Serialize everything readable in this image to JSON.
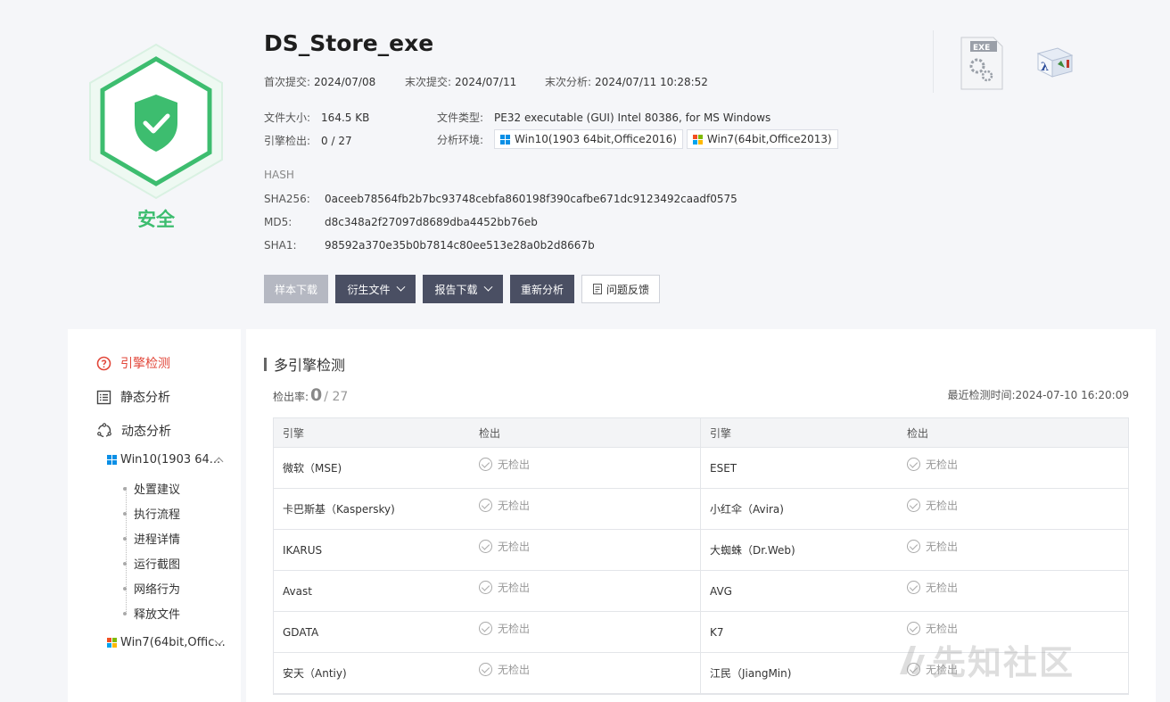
{
  "file": {
    "name": "DS_Store_exe",
    "verdict": "安全",
    "first_submit_label": "首次提交:",
    "first_submit": "2024/07/08",
    "last_submit_label": "末次提交:",
    "last_submit": "2024/07/11",
    "last_analysis_label": "末次分析:",
    "last_analysis": "2024/07/11 10:28:52",
    "size_label": "文件大小:",
    "size": "164.5 KB",
    "type_label": "文件类型:",
    "type": "PE32 executable (GUI) Intel 80386, for MS Windows",
    "detect_label": "引擎检出:",
    "detect": "0 / 27",
    "env_label": "分析环境:",
    "envs": [
      "Win10(1903 64bit,Office2016)",
      "Win7(64bit,Office2013)"
    ]
  },
  "hash": {
    "heading": "HASH",
    "sha256_label": "SHA256:",
    "sha256": "0aceeb78564fb2b7bc93748cebfa860198f390cafbe671dc9123492caadf0575",
    "md5_label": "MD5:",
    "md5": "d8c348a2f27097d8689dba4452bb76eb",
    "sha1_label": "SHA1:",
    "sha1": "98592a370e35b0b7814c80ee513e28a0b2d8667b"
  },
  "actions": {
    "sample_download": "样本下载",
    "derived_files": "衍生文件",
    "report_download": "报告下载",
    "reanalyze": "重新分析",
    "feedback": "问题反馈"
  },
  "sidebar": {
    "engine": "引擎检测",
    "static": "静态分析",
    "dynamic": "动态分析",
    "env1": "Win10(1903 64...",
    "env2": "Win7(64bit,Offic...",
    "sub_items": [
      "处置建议",
      "执行流程",
      "进程详情",
      "运行截图",
      "网络行为",
      "释放文件"
    ]
  },
  "panel": {
    "title": "多引擎检测",
    "rate_label": "检出率:",
    "rate_count": "0",
    "rate_total": "/ 27",
    "last_time_label": "最近检测时间:",
    "last_time": "2024-07-10 16:20:09",
    "col_engine": "引擎",
    "col_result": "检出",
    "rows": [
      {
        "e1": "微软（MSE)",
        "r1": "无检出",
        "e2": "ESET",
        "r2": "无检出"
      },
      {
        "e1": "卡巴斯基（Kaspersky)",
        "r1": "无检出",
        "e2": "小红伞（Avira)",
        "r2": "无检出"
      },
      {
        "e1": "IKARUS",
        "r1": "无检出",
        "e2": "大蜘蛛（Dr.Web)",
        "r2": "无检出"
      },
      {
        "e1": "Avast",
        "r1": "无检出",
        "e2": "AVG",
        "r2": "无检出"
      },
      {
        "e1": "GDATA",
        "r1": "无检出",
        "e2": "K7",
        "r2": "无检出"
      },
      {
        "e1": "安天（Antiy)",
        "r1": "无检出",
        "e2": "江民（JiangMin)",
        "r2": "无检出"
      }
    ]
  },
  "file_icon_text": "EXE",
  "watermark": "先知社区",
  "colors": {
    "safe": "#3dbd6f",
    "active": "#e2473a",
    "button": "#4a4f63"
  }
}
